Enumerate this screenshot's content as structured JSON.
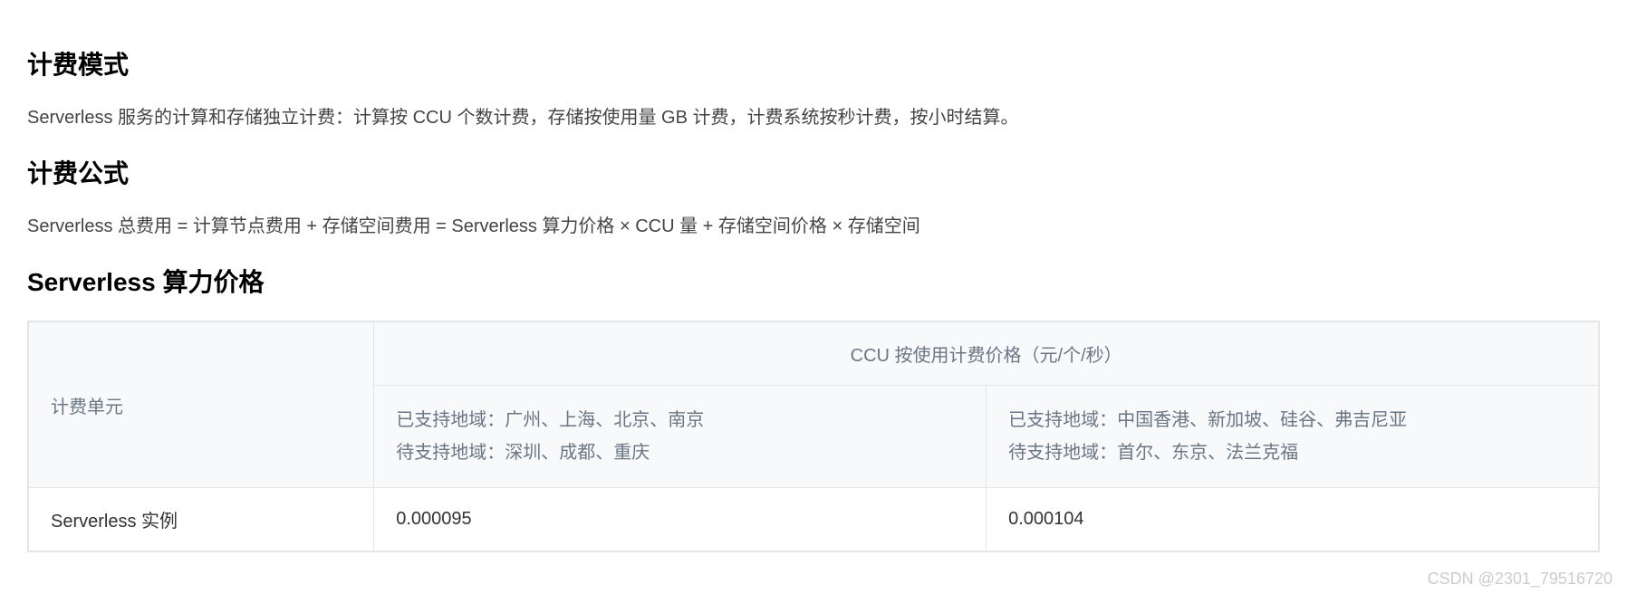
{
  "sections": {
    "billing_mode": {
      "title": "计费模式",
      "description": "Serverless 服务的计算和存储独立计费：计算按 CCU 个数计费，存储按使用量 GB 计费，计费系统按秒计费，按小时结算。"
    },
    "billing_formula": {
      "title": "计费公式",
      "description": "Serverless 总费用 = 计算节点费用 + 存储空间费用 = Serverless 算力价格 × CCU 量 + 存储空间价格 × 存储空间"
    },
    "compute_price": {
      "title": "Serverless 算力价格"
    }
  },
  "table": {
    "header": {
      "billing_unit": "计费单元",
      "ccu_price_header": "CCU 按使用计费价格（元/个/秒）",
      "region1_supported": "已支持地域：广州、上海、北京、南京",
      "region1_pending": "待支持地域：深圳、成都、重庆",
      "region2_supported": "已支持地域：中国香港、新加坡、硅谷、弗吉尼亚",
      "region2_pending": "待支持地域：首尔、东京、法兰克福"
    },
    "row": {
      "unit": "Serverless 实例",
      "price1": "0.000095",
      "price2": "0.000104"
    }
  },
  "watermark": "CSDN @2301_79516720"
}
